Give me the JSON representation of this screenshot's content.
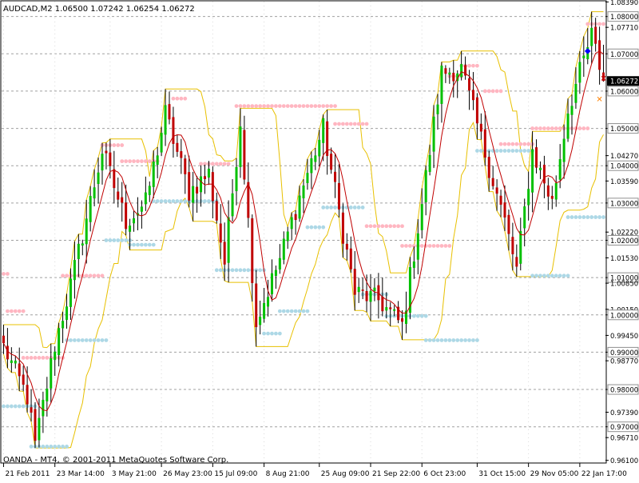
{
  "chart_data": {
    "type": "candlestick",
    "header": "AUDCAD,M2  1.06500 1.07242 1.06254 1.06272",
    "footer": "OANDA - MT4, © 2001-2011 MetaQuotes Software Corp.",
    "current_price": "1.06272",
    "ylim": [
      0.9605,
      1.084
    ],
    "y_tick_labels": [
      {
        "value": 1.0839,
        "label": "1.08390",
        "boxed": false
      },
      {
        "value": 1.08,
        "label": "1.08000",
        "boxed": true
      },
      {
        "value": 1.0771,
        "label": "1.07710",
        "boxed": false
      },
      {
        "value": 1.07,
        "label": "1.07000",
        "boxed": true
      },
      {
        "value": 1.06,
        "label": "1.06000",
        "boxed": true
      },
      {
        "value": 1.05,
        "label": "1.05000",
        "boxed": true
      },
      {
        "value": 1.0427,
        "label": "1.04270",
        "boxed": false
      },
      {
        "value": 1.04,
        "label": "1.04000",
        "boxed": true
      },
      {
        "value": 1.0359,
        "label": "1.03590",
        "boxed": false
      },
      {
        "value": 1.03,
        "label": "1.03000",
        "boxed": true
      },
      {
        "value": 1.0222,
        "label": "1.02220",
        "boxed": false
      },
      {
        "value": 1.02,
        "label": "1.02000",
        "boxed": true
      },
      {
        "value": 1.0153,
        "label": "1.01530",
        "boxed": false
      },
      {
        "value": 1.01,
        "label": "1.01000",
        "boxed": true
      },
      {
        "value": 1.0085,
        "label": "1.00850",
        "boxed": false
      },
      {
        "value": 1.0015,
        "label": "1.00150",
        "boxed": false
      },
      {
        "value": 1.0,
        "label": "1.00000",
        "boxed": true
      },
      {
        "value": 0.9945,
        "label": "0.99450",
        "boxed": false
      },
      {
        "value": 0.99,
        "label": "0.99000",
        "boxed": true
      },
      {
        "value": 0.9877,
        "label": "0.98770",
        "boxed": false
      },
      {
        "value": 0.98,
        "label": "0.98000",
        "boxed": true
      },
      {
        "value": 0.9739,
        "label": "0.97390",
        "boxed": false
      },
      {
        "value": 0.97,
        "label": "0.97000",
        "boxed": true
      },
      {
        "value": 0.9671,
        "label": "0.96710",
        "boxed": false
      },
      {
        "value": 0.961,
        "label": "0.96100",
        "boxed": false
      }
    ],
    "grid_levels": [
      1.08,
      1.07,
      1.06,
      1.05,
      1.04,
      1.03,
      1.02,
      1.01,
      1.0,
      0.99,
      0.98,
      0.97
    ],
    "x_tick_labels": [
      "21 Feb 2011",
      "23 Mar 14:00",
      "3 May 21:00",
      "26 May 23:00",
      "15 Jul 09:00",
      "8 Aug 21:00",
      "25 Aug 09:00",
      "21 Sep 22:00",
      "6 Oct 23:00",
      "31 Oct 15:00",
      "29 Nov 05:00",
      "22 Jan 17:00"
    ],
    "x_tick_positions": [
      0,
      13,
      27,
      40,
      53,
      66,
      80,
      93,
      106,
      120,
      133,
      146
    ],
    "bar_count": 153,
    "price_path": [
      [
        0,
        0.9915
      ],
      [
        6,
        0.978
      ],
      [
        8,
        0.965
      ],
      [
        13,
        0.992
      ],
      [
        17,
        1.008
      ],
      [
        25,
        1.044
      ],
      [
        31,
        1.025
      ],
      [
        36,
        1.03
      ],
      [
        41,
        1.054
      ],
      [
        47,
        1.033
      ],
      [
        52,
        1.038
      ],
      [
        56,
        1.014
      ],
      [
        60,
        1.052
      ],
      [
        64,
        0.998
      ],
      [
        70,
        1.015
      ],
      [
        76,
        1.035
      ],
      [
        81,
        1.05
      ],
      [
        86,
        1.022
      ],
      [
        89,
        1.006
      ],
      [
        95,
        1.004
      ],
      [
        101,
        0.997
      ],
      [
        106,
        1.03
      ],
      [
        111,
        1.065
      ],
      [
        116,
        1.066
      ],
      [
        121,
        1.047
      ],
      [
        127,
        1.025
      ],
      [
        130,
        1.012
      ],
      [
        134,
        1.044
      ],
      [
        139,
        1.03
      ],
      [
        143,
        1.055
      ],
      [
        149,
        1.075
      ],
      [
        152,
        1.0627
      ]
    ],
    "resistance_levels": [
      {
        "from": 0,
        "to": 1,
        "value": 1.011
      },
      {
        "from": 1,
        "to": 5,
        "value": 1.001
      },
      {
        "from": 5,
        "to": 15,
        "value": 0.9885
      },
      {
        "from": 15,
        "to": 25,
        "value": 1.0105
      },
      {
        "from": 25,
        "to": 30,
        "value": 1.0455
      },
      {
        "from": 30,
        "to": 39,
        "value": 1.0412
      },
      {
        "from": 43,
        "to": 46,
        "value": 1.058
      },
      {
        "from": 50,
        "to": 57,
        "value": 1.0405
      },
      {
        "from": 59,
        "to": 84,
        "value": 1.056
      },
      {
        "from": 84,
        "to": 92,
        "value": 1.0512
      },
      {
        "from": 92,
        "to": 101,
        "value": 1.0238
      },
      {
        "from": 101,
        "to": 113,
        "value": 1.0185
      },
      {
        "from": 113,
        "to": 116,
        "value": 1.064
      },
      {
        "from": 116,
        "to": 120,
        "value": 1.0668
      },
      {
        "from": 122,
        "to": 126,
        "value": 1.06
      },
      {
        "from": 126,
        "to": 134,
        "value": 1.0458
      },
      {
        "from": 134,
        "to": 148,
        "value": 1.05
      },
      {
        "from": 148,
        "to": 152,
        "value": 1.078
      }
    ],
    "support_levels": [
      {
        "from": 0,
        "to": 8,
        "value": 0.9755
      },
      {
        "from": 7,
        "to": 16,
        "value": 0.9647
      },
      {
        "from": 16,
        "to": 26,
        "value": 0.9932
      },
      {
        "from": 26,
        "to": 32,
        "value": 1.02
      },
      {
        "from": 32,
        "to": 38,
        "value": 1.0188
      },
      {
        "from": 38,
        "to": 54,
        "value": 1.0305
      },
      {
        "from": 54,
        "to": 66,
        "value": 1.012
      },
      {
        "from": 66,
        "to": 70,
        "value": 0.995
      },
      {
        "from": 70,
        "to": 77,
        "value": 1.001
      },
      {
        "from": 77,
        "to": 81,
        "value": 1.0235
      },
      {
        "from": 81,
        "to": 91,
        "value": 1.0288
      },
      {
        "from": 91,
        "to": 97,
        "value": 1.0055
      },
      {
        "from": 97,
        "to": 107,
        "value": 0.9997
      },
      {
        "from": 107,
        "to": 120,
        "value": 0.9932
      },
      {
        "from": 120,
        "to": 134,
        "value": 1.044
      },
      {
        "from": 134,
        "to": 143,
        "value": 1.0105
      },
      {
        "from": 143,
        "to": 153,
        "value": 1.0262
      }
    ],
    "markers": [
      {
        "index": 148,
        "value": 1.071,
        "symbol": "◆",
        "color": "#0000ff"
      },
      {
        "index": 151,
        "value": 1.058,
        "symbol": "✕",
        "color": "#ff8000"
      },
      {
        "index": 152,
        "value": 1.0635,
        "symbol": "✕",
        "color": "#c00000"
      }
    ],
    "colors": {
      "bull": "#00c000",
      "bear": "#c00000",
      "ma": "#c00000",
      "channel": "#e8c000",
      "resistance": "#ffb6c1",
      "support": "#add8e6",
      "grid": "#a0a0a0",
      "frame": "#000000",
      "price_box": "#000000"
    }
  }
}
